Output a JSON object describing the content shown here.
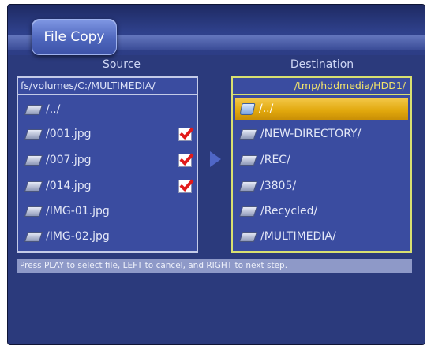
{
  "app": {
    "title": "File Copy"
  },
  "source": {
    "heading": "Source",
    "path": "fs/volumes/C:/MULTIMEDIA/",
    "items": [
      {
        "label": "/../",
        "icon": "file-icon",
        "checked": false
      },
      {
        "label": "/001.jpg",
        "icon": "file-icon",
        "checked": true
      },
      {
        "label": "/007.jpg",
        "icon": "file-icon",
        "checked": true
      },
      {
        "label": "/014.jpg",
        "icon": "file-icon",
        "checked": true
      },
      {
        "label": "/IMG-01.jpg",
        "icon": "file-icon",
        "checked": false
      },
      {
        "label": "/IMG-02.jpg",
        "icon": "file-icon",
        "checked": false
      }
    ]
  },
  "destination": {
    "heading": "Destination",
    "path": "/tmp/hddmedia/HDD1/",
    "items": [
      {
        "label": "/../",
        "icon": "folder-open-icon",
        "selected": true
      },
      {
        "label": "/NEW-DIRECTORY/",
        "icon": "file-icon",
        "selected": false
      },
      {
        "label": "/REC/",
        "icon": "file-icon",
        "selected": false
      },
      {
        "label": "/3805/",
        "icon": "file-icon",
        "selected": false
      },
      {
        "label": "/Recycled/",
        "icon": "file-icon",
        "selected": false
      },
      {
        "label": "/MULTIMEDIA/",
        "icon": "file-icon",
        "selected": false
      }
    ]
  },
  "status": {
    "hint": "Press PLAY to select file, LEFT to cancel, and RIGHT to next step."
  },
  "colors": {
    "background": "#2b3a7c",
    "panel": "#3a4ca0",
    "selection": "#e1a70c",
    "destination_border": "#d9e070",
    "check_mark": "#e11a1a"
  }
}
